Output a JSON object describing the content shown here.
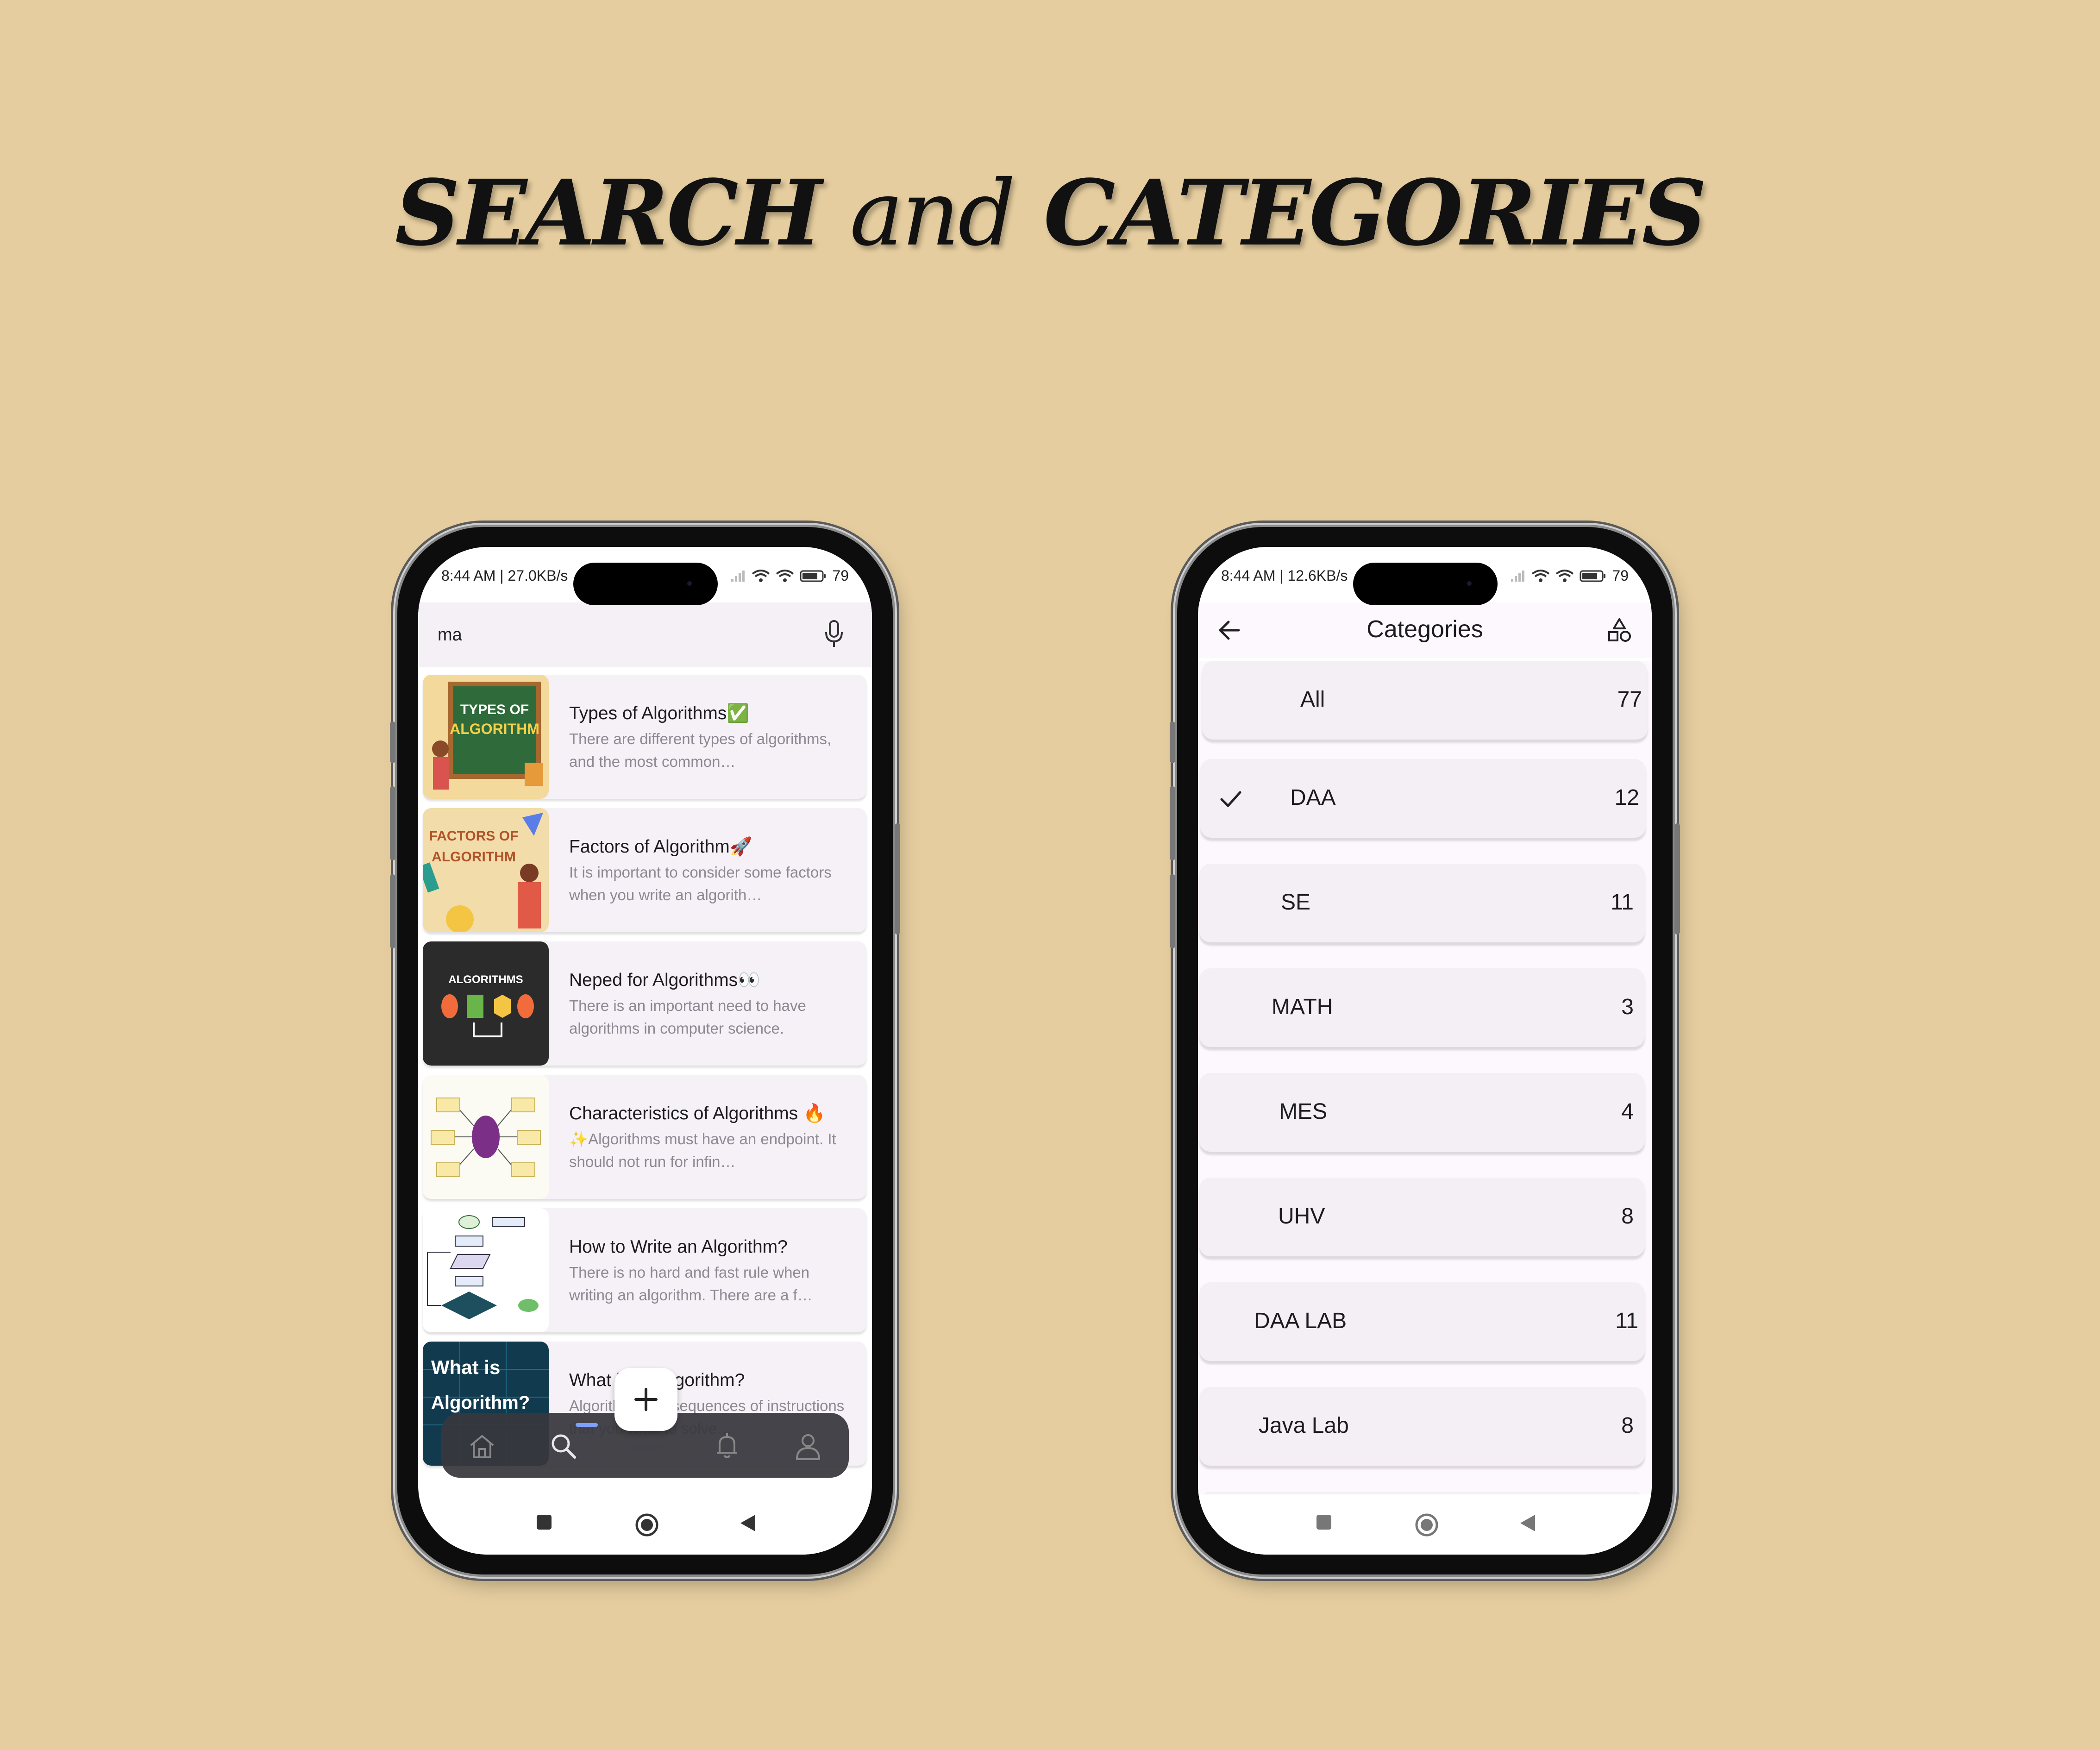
{
  "headline": {
    "part1": "SEARCH ",
    "part2": "and",
    "part3": " CATEGORIES"
  },
  "search_screen": {
    "status": {
      "time": "8:44 AM | 27.0KB/s",
      "battery": "79"
    },
    "search": {
      "value": "ma",
      "mic_icon": "microphone-icon"
    },
    "results": [
      {
        "title": "Types of Algorithms✅",
        "description": "There are different types of algorithms, and the most common…",
        "thumbnail_text": [
          "TYPES OF",
          "ALGORITHM"
        ]
      },
      {
        "title": "Factors of Algorithm🚀",
        "description": "It is important to consider some factors when you write an algorith…",
        "thumbnail_text": [
          "FACTORS OF",
          "ALGORITHM"
        ]
      },
      {
        "title": "Neped for Algorithms👀",
        "description": "There is an important need to have algorithms in computer science.",
        "thumbnail_text": [
          "ALGORITHMS"
        ]
      },
      {
        "title": "Characteristics of Algorithms 🔥",
        "description": "✨Algorithms must have an endpoint. It should not run for infin…",
        "thumbnail_text": []
      },
      {
        "title": "How to Write an Algorithm?",
        "description": "There is no hard and fast rule when writing an algorithm. There are a f…",
        "thumbnail_text": []
      },
      {
        "title": "What is an Algorithm?",
        "description": "Algorithms are sequences of instructions that you write to solve…",
        "thumbnail_text": [
          "What is",
          "Algorithm?"
        ]
      }
    ],
    "bottom_nav": [
      "home-icon",
      "search-icon",
      "bell-icon",
      "profile-icon"
    ],
    "active_nav": "search",
    "fab_icon": "plus-icon",
    "system_nav": [
      "square-icon",
      "circle-icon",
      "back-triangle-icon"
    ]
  },
  "categories_screen": {
    "status": {
      "time": "8:44 AM | 12.6KB/s",
      "battery": "79"
    },
    "title": "Categories",
    "back_icon": "arrow-left-icon",
    "shapes_icon": "shapes-icon",
    "selected": "DAA",
    "items": [
      {
        "name": "All",
        "count": "77"
      },
      {
        "name": "DAA",
        "count": "12"
      },
      {
        "name": "SE",
        "count": "11"
      },
      {
        "name": "MATH",
        "count": "3"
      },
      {
        "name": "MES",
        "count": "4"
      },
      {
        "name": "UHV",
        "count": "8"
      },
      {
        "name": "DAA LAB",
        "count": "11"
      },
      {
        "name": "Java Lab",
        "count": "8"
      }
    ]
  },
  "colors": {
    "background": "#E5CD9F",
    "card": "#F5F1F7",
    "nav_bar": "#37373C",
    "nav_indicator": "#7DA0FF"
  }
}
